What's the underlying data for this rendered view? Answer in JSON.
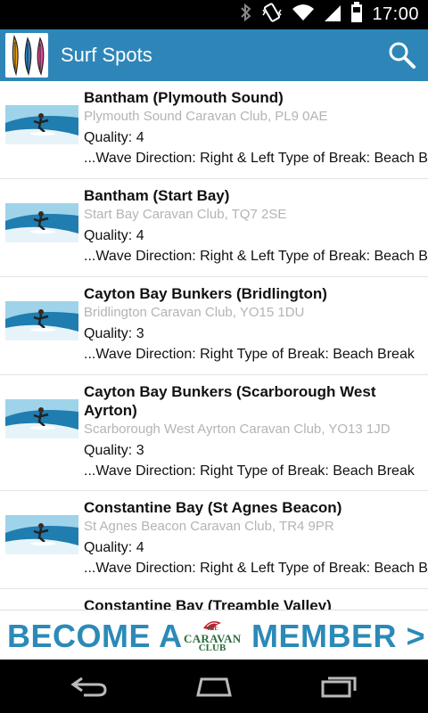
{
  "status_bar": {
    "time": "17:00",
    "icons": [
      "bluetooth-icon",
      "vibrate-icon",
      "wifi-icon",
      "signal-icon",
      "battery-icon"
    ]
  },
  "action_bar": {
    "title": "Surf Spots",
    "search_icon": "search-icon",
    "color": "#2e86b8"
  },
  "spots": [
    {
      "name": "Bantham (Plymouth Sound)",
      "club": "Plymouth Sound Caravan Club, PL9 0AE",
      "quality": "Quality: 4",
      "details": "...Wave Direction: Right & Left   Type of Break: Beach Break"
    },
    {
      "name": "Bantham (Start Bay)",
      "club": "Start Bay Caravan Club, TQ7 2SE",
      "quality": "Quality: 4",
      "details": "...Wave Direction: Right & Left   Type of Break: Beach Break"
    },
    {
      "name": "Cayton Bay Bunkers (Bridlington)",
      "club": "Bridlington Caravan Club, YO15 1DU",
      "quality": "Quality: 3",
      "details": "...Wave Direction: Right   Type of Break: Beach Break"
    },
    {
      "name": "Cayton Bay Bunkers (Scarborough West Ayrton)",
      "club": "Scarborough West Ayrton Caravan Club, YO13 1JD",
      "quality": "Quality: 3",
      "details": "...Wave Direction: Right   Type of Break: Beach Break"
    },
    {
      "name": "Constantine Bay (St Agnes Beacon)",
      "club": "St Agnes Beacon Caravan Club, TR4 9PR",
      "quality": "Quality: 4",
      "details": "...Wave Direction: Right & Left   Type of Break: Beach Break"
    },
    {
      "name": "Constantine Bay (Treamble Valley)",
      "club": "",
      "quality": "",
      "details": ""
    }
  ],
  "banner": {
    "left_text": "BECOME A",
    "right_text": "MEMBER >",
    "logo_the": "THE",
    "logo_caravan": "CARAVAN",
    "logo_club": "CLUB",
    "color": "#2b8ab8"
  },
  "nav_bar": {
    "buttons": [
      "back-icon",
      "home-icon",
      "recent-apps-icon"
    ]
  }
}
